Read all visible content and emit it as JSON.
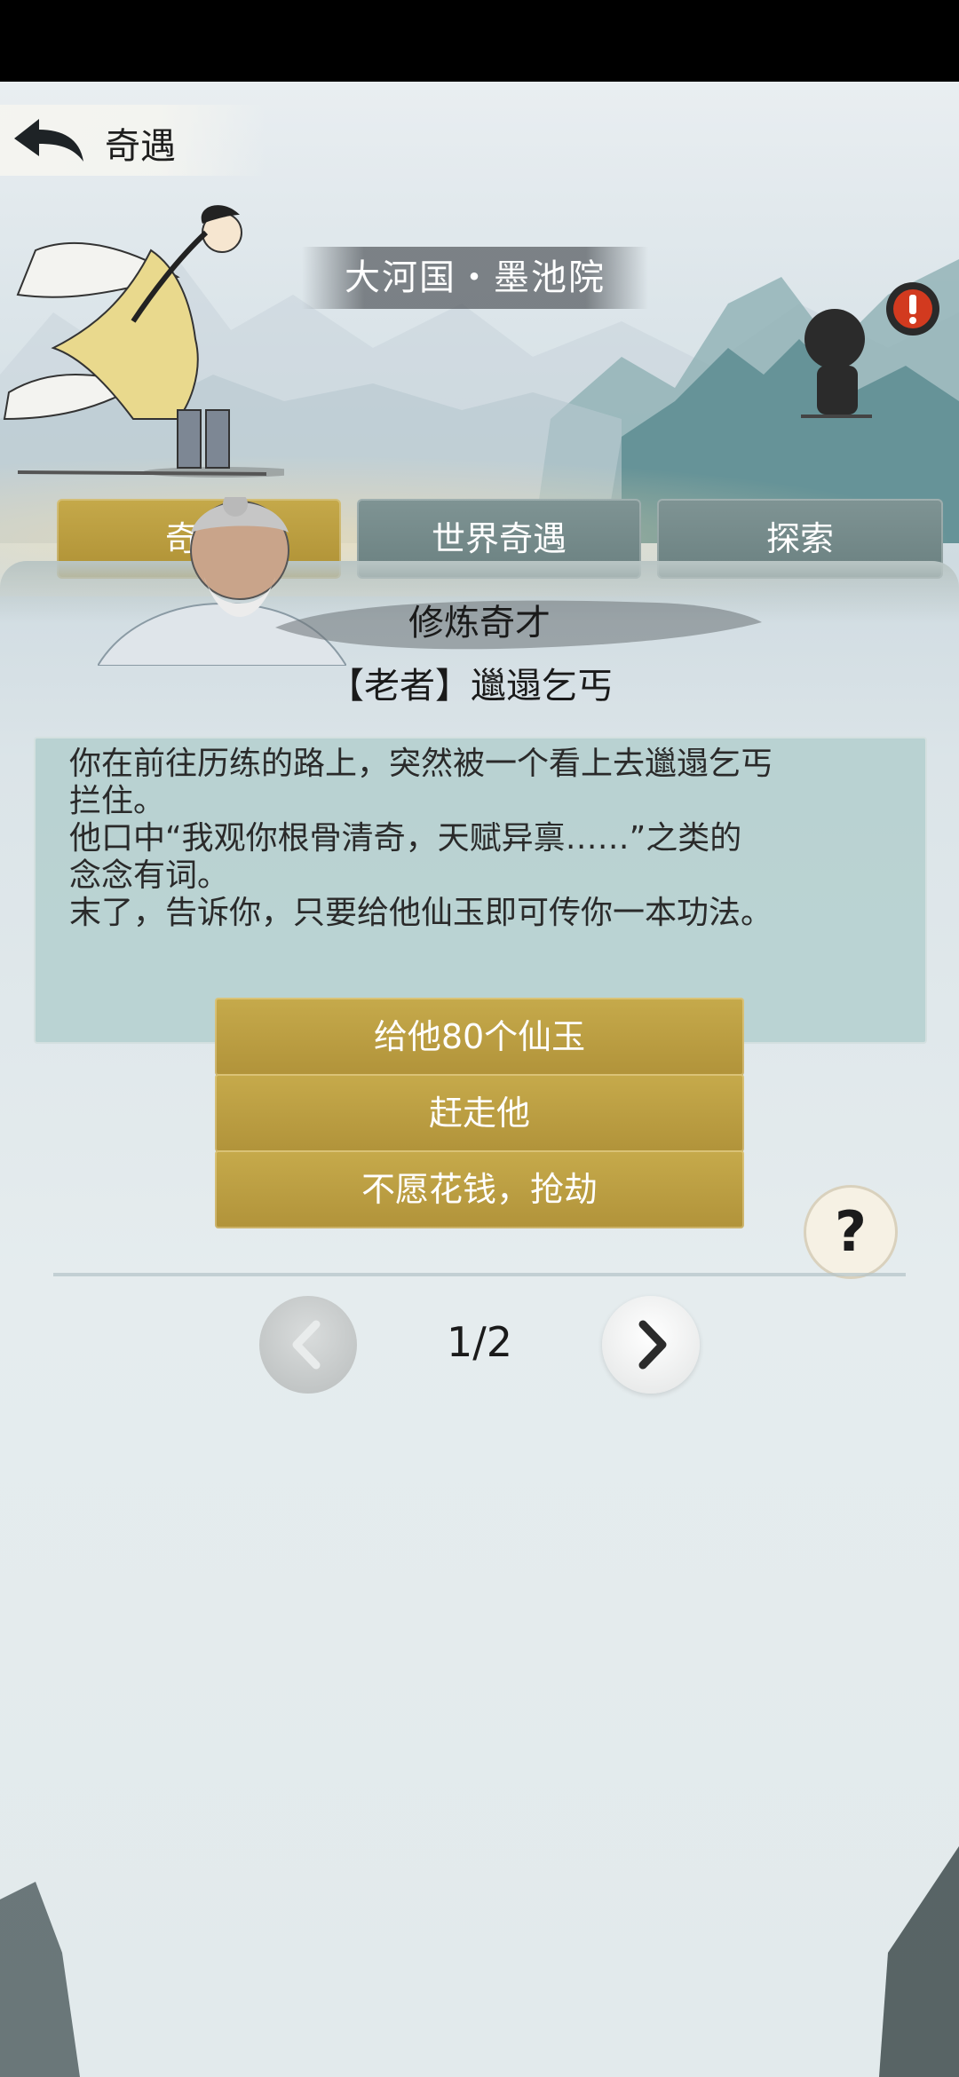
{
  "header": {
    "title": "奇遇"
  },
  "location": "大河国・墨池院",
  "tabs": [
    {
      "label": "奇遇",
      "active": true
    },
    {
      "label": "世界奇遇",
      "active": false
    },
    {
      "label": "探索",
      "active": false
    }
  ],
  "event": {
    "title": "修炼奇才",
    "npc": "【老者】邋遢乞丐",
    "story": [
      "你在前往历练的路上，突然被一个看上去邋遢乞丐",
      "拦住。",
      "他口中“我观你根骨清奇，天赋异禀……”之类的",
      "念念有词。",
      "末了，告诉你，只要给他仙玉即可传你一本功法。"
    ]
  },
  "choices": [
    {
      "label": "给他80个仙玉"
    },
    {
      "label": "赶走他"
    },
    {
      "label": "不愿花钱，抢劫"
    }
  ],
  "pager": {
    "text": "1/2"
  },
  "icons": {
    "back": "back-arrow-icon",
    "alert": "exclamation-icon",
    "help": "question-icon",
    "prev": "chevron-left-icon",
    "next": "chevron-right-icon"
  },
  "colors": {
    "gold": "#b8993e",
    "teal": "#748a8a",
    "panel": "#afcdcc"
  }
}
